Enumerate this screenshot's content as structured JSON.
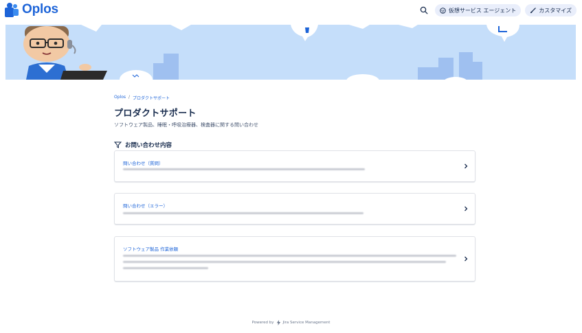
{
  "header": {
    "brand": "Oplos",
    "search_icon": "search-icon",
    "virtual_agent_label": "仮想サービス エージェント",
    "customize_label": "カスタマイズ"
  },
  "banner": {
    "background_color": "#c5defa"
  },
  "breadcrumb": {
    "items": [
      "Oplos",
      "プロダクトサポート"
    ],
    "separator": "/"
  },
  "page": {
    "title": "プロダクトサポート",
    "description": "ソフトウェア製品、睡眠・呼吸治療器、検査器に関する問い合わせ"
  },
  "section": {
    "heading": "お問い合わせ内容"
  },
  "request_types": [
    {
      "title": "問い合わせ（質問）"
    },
    {
      "title": "問い合わせ（エラー）"
    },
    {
      "title": "ソフトウェア製品 作業依頼"
    }
  ],
  "footer": {
    "powered_by": "Powered by",
    "product": "Jira Service Management"
  },
  "colors": {
    "brand_blue": "#1d64d8",
    "pill_bg": "#e9eefb",
    "text": "#172b4d"
  }
}
